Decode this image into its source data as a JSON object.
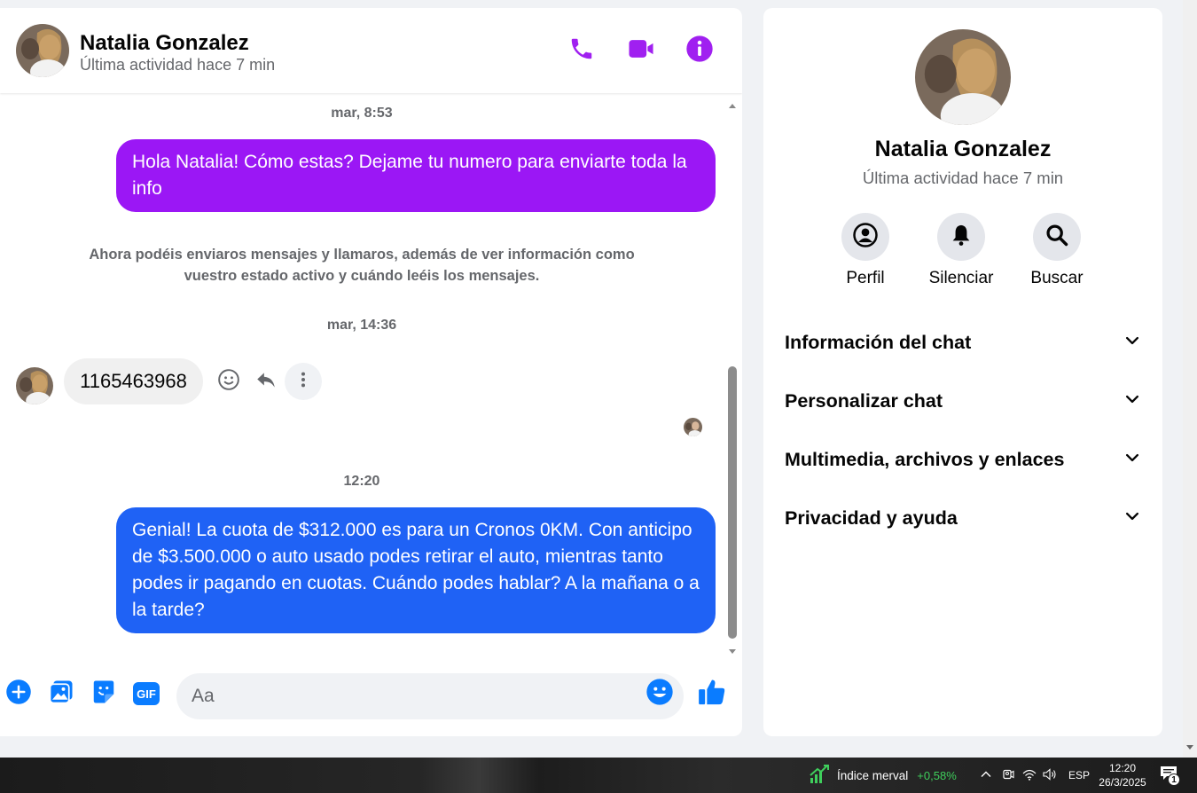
{
  "colors": {
    "messenger_purple": "#a020f0",
    "bubble_purple": "#9b17f5",
    "bubble_blue": "#1f62f5",
    "icon_blue": "#0a7cff",
    "stock_green": "#3fcf5c"
  },
  "header": {
    "name": "Natalia Gonzalez",
    "status": "Última actividad hace 7 min",
    "actions": [
      "phone-icon",
      "video-icon",
      "info-icon"
    ]
  },
  "messages": {
    "ts1": "mar, 8:53",
    "out1": "Hola Natalia! Cómo estas? Dejame tu numero para enviarte toda la info",
    "system_note": "Ahora podéis enviaros mensajes y llamaros, además de ver información como vuestro estado activo y cuándo leéis los mensajes.",
    "ts2": "mar, 14:36",
    "in1": "1165463968",
    "ts3": "12:20",
    "out2": "Genial! La cuota de $312.000 es para un Cronos 0KM. Con anticipo de $3.500.000 o auto usado podes retirar el auto, mientras tanto podes ir pagando en cuotas. Cuándo podes hablar? A la mañana o a la tarde?"
  },
  "composer": {
    "placeholder": "Aa",
    "icons": [
      "plus-icon",
      "photo-icon",
      "sticker-icon",
      "gif-icon",
      "emoji-icon",
      "thumbs-up-icon"
    ],
    "gif_label": "GIF"
  },
  "info": {
    "name": "Natalia Gonzalez",
    "status": "Última actividad hace 7 min",
    "quick_actions": [
      {
        "label": "Perfil",
        "icon": "profile-icon"
      },
      {
        "label": "Silenciar",
        "icon": "bell-icon"
      },
      {
        "label": "Buscar",
        "icon": "search-icon"
      }
    ],
    "sections": [
      {
        "label": "Información del chat"
      },
      {
        "label": "Personalizar chat"
      },
      {
        "label": "Multimedia, archivos y enlaces"
      },
      {
        "label": "Privacidad y ayuda"
      }
    ]
  },
  "taskbar": {
    "stock_name": "Índice merval",
    "stock_change": "+0,58%",
    "language": "ESP",
    "time": "12:20",
    "date": "26/3/2025",
    "notification_count": "1"
  }
}
